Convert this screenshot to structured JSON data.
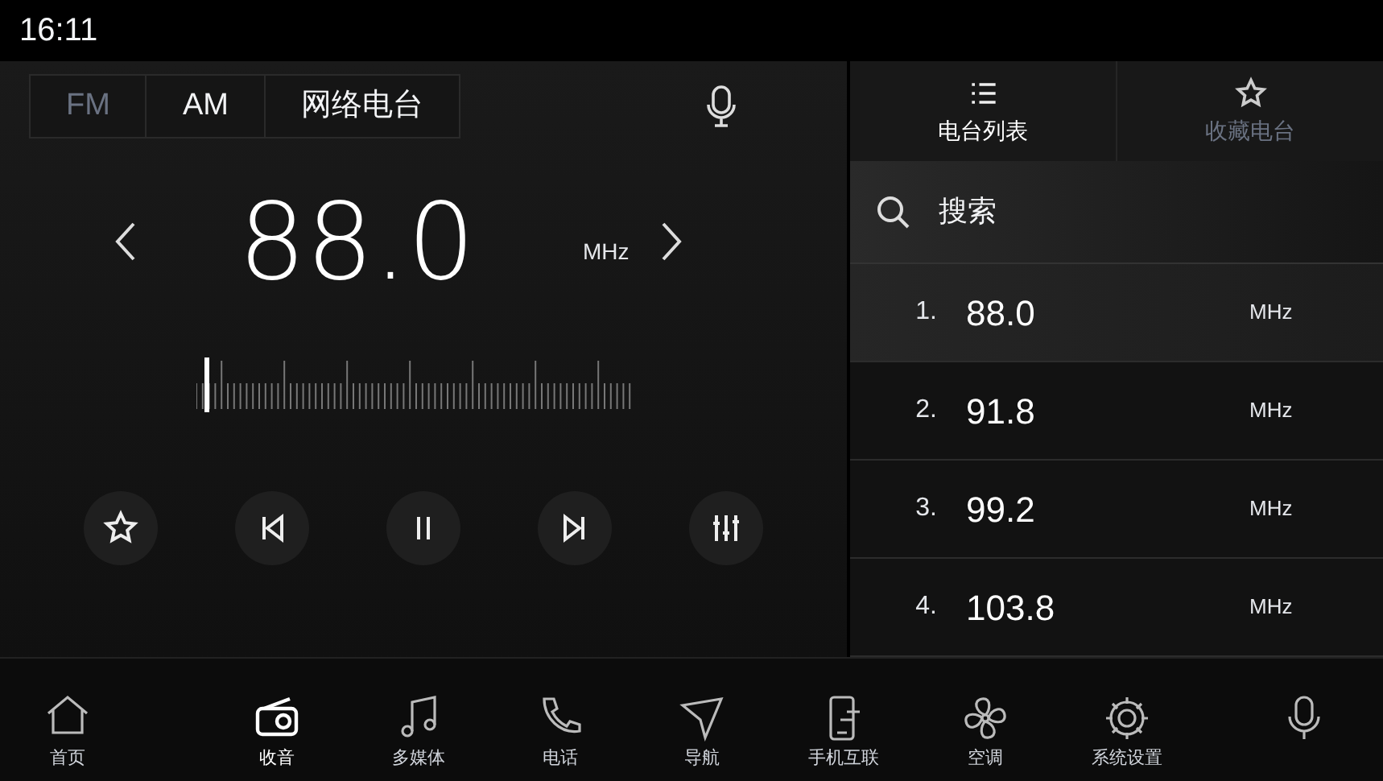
{
  "status_bar": {
    "time": "16:11"
  },
  "bands": [
    {
      "label": "FM",
      "selected": true
    },
    {
      "label": "AM",
      "selected": false
    },
    {
      "label": "网络电台",
      "selected": false
    }
  ],
  "tuner": {
    "frequency": "88.0",
    "unit": "MHz",
    "level": 0.02
  },
  "panel_tabs": [
    {
      "label": "电台列表",
      "selected": true
    },
    {
      "label": "收藏电台",
      "selected": false
    }
  ],
  "search": {
    "placeholder": "搜索"
  },
  "stations": [
    {
      "index": "1.",
      "frequency": "88.0",
      "unit": "MHz",
      "selected": true
    },
    {
      "index": "2.",
      "frequency": "91.8",
      "unit": "MHz",
      "selected": false
    },
    {
      "index": "3.",
      "frequency": "99.2",
      "unit": "MHz",
      "selected": false
    },
    {
      "index": "4.",
      "frequency": "103.8",
      "unit": "MHz",
      "selected": false
    }
  ],
  "dock": [
    {
      "label": "首页",
      "selected": false
    },
    {
      "label": "收音",
      "selected": true
    },
    {
      "label": "多媒体",
      "selected": false
    },
    {
      "label": "电话",
      "selected": false
    },
    {
      "label": "导航",
      "selected": false
    },
    {
      "label": "手机互联",
      "selected": false
    },
    {
      "label": "空调",
      "selected": false
    },
    {
      "label": "系统设置",
      "selected": false
    },
    {
      "selected": false
    }
  ]
}
